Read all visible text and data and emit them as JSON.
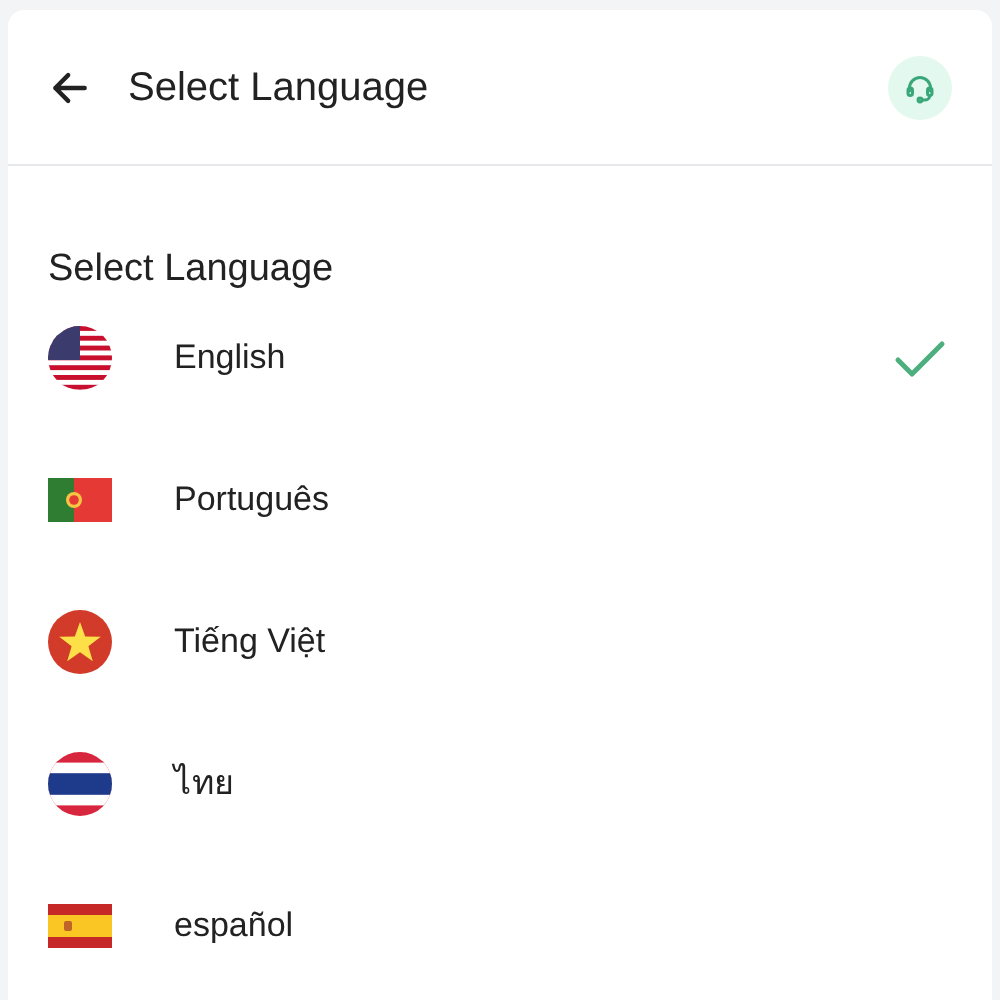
{
  "header": {
    "title": "Select Language"
  },
  "section_title": "Select Language",
  "languages": [
    {
      "label": "English",
      "selected": true
    },
    {
      "label": "Português",
      "selected": false
    },
    {
      "label": "Tiếng Việt",
      "selected": false
    },
    {
      "label": "ไทย",
      "selected": false
    },
    {
      "label": "español",
      "selected": false
    }
  ]
}
